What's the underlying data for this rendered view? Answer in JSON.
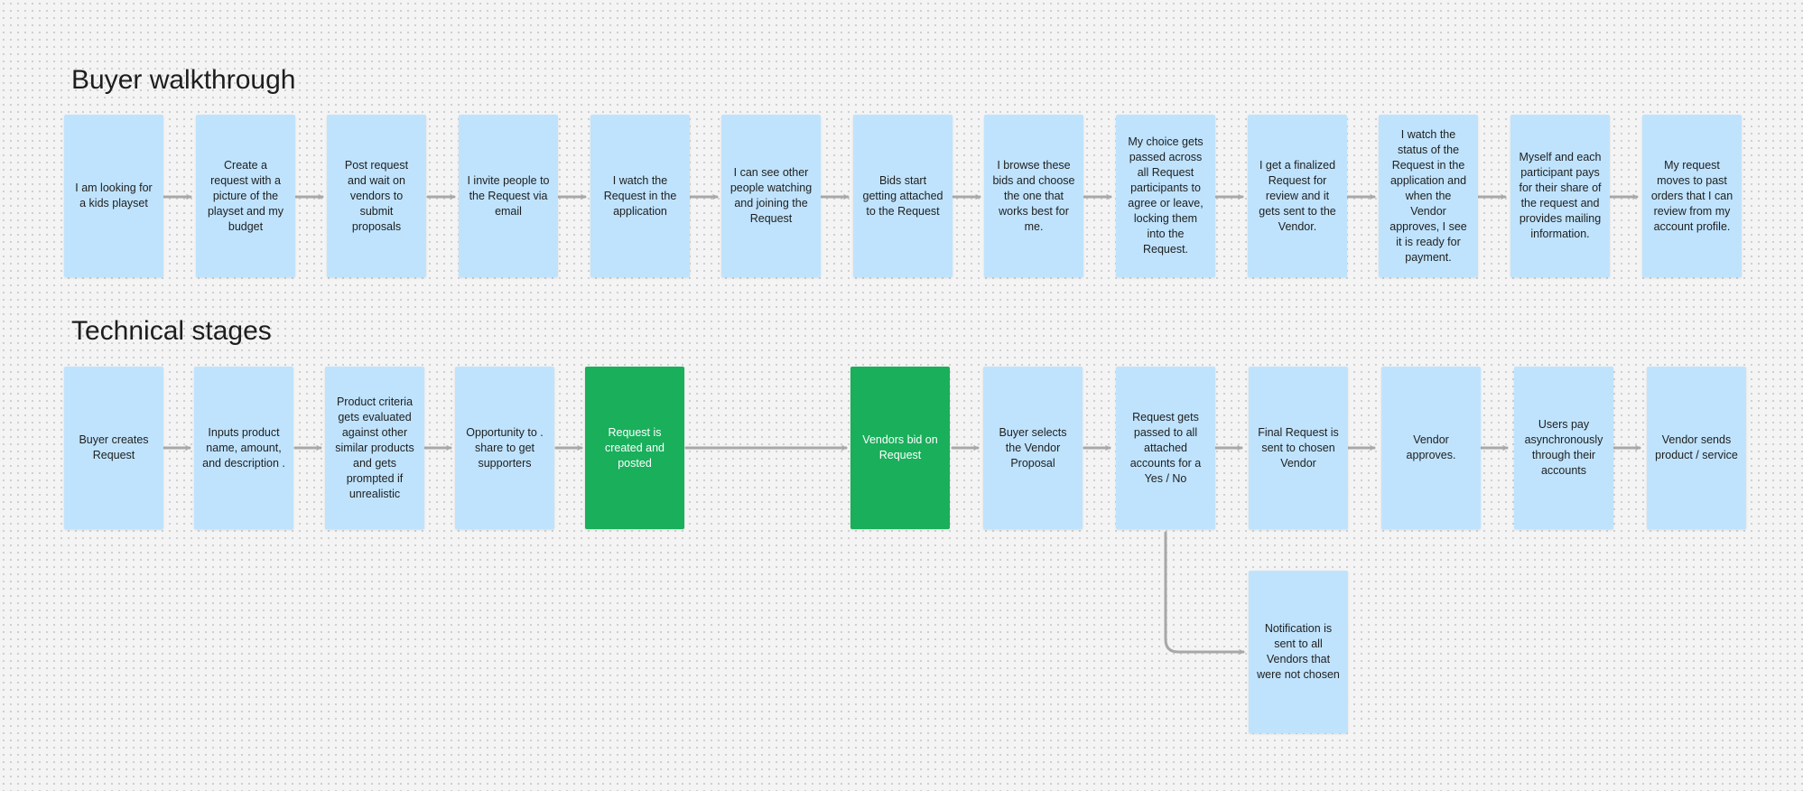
{
  "sections": {
    "buyer_walkthrough": {
      "title": "Buyer walkthrough",
      "notes": [
        "I am looking for a kids playset",
        "Create a request with a picture of the playset and my budget",
        "Post request and wait on vendors to submit proposals",
        "I invite people to the Request via email",
        "I watch the Request in the application",
        "I can see other people watching and joining the Request",
        "Bids start getting attached to the Request",
        "I browse these bids and choose the one that works best for me.",
        "My choice gets passed across all Request participants to agree or leave, locking them into the Request.",
        "I get a finalized Request for review and it gets sent to the Vendor.",
        "I watch the status of the Request in the application and when the Vendor approves, I see it is ready for payment.",
        "Myself and each participant pays for their share of the request and provides mailing information.",
        "My request moves to past orders that I can review from my account profile."
      ]
    },
    "technical_stages": {
      "title": "Technical stages",
      "notes": [
        "Buyer creates Request",
        "Inputs product name, amount, and description .",
        "Product criteria gets evaluated against other similar products and gets prompted if unrealistic",
        "Opportunity to . share to get supporters",
        "Request is created and posted",
        "Vendors bid on Request",
        "Buyer selects the Vendor Proposal",
        "Request gets passed to all attached accounts for a Yes / No",
        "Final Request is sent to chosen Vendor",
        "Vendor approves.",
        "Users pay asynchronously through their accounts",
        "Vendor sends product / service"
      ],
      "branch_note": "Notification is sent to all Vendors that were not chosen"
    }
  },
  "colors": {
    "canvas": "#f4f4f4",
    "note_blue": "#bfe3fd",
    "note_green": "#19af5b",
    "connector": "#a8a8a8",
    "title_text": "#1e1e1e"
  }
}
